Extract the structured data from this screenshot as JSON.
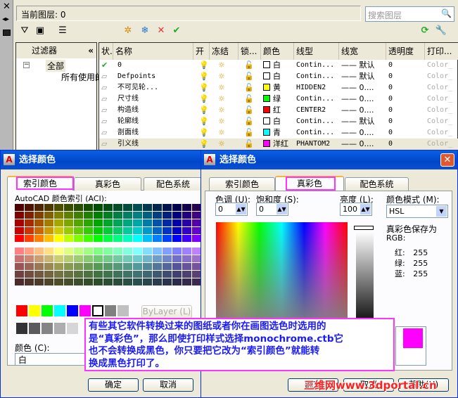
{
  "layer_manager": {
    "current_layer_label": "当前图层: 0",
    "search_placeholder": "搜索图层",
    "filter_header": "过滤器",
    "tree": [
      "全部",
      "所有使用的图层"
    ],
    "columns": [
      "状.",
      "名称",
      "开",
      "冻结",
      "锁...",
      "颜色",
      "线型",
      "线宽",
      "透明度",
      "打印..."
    ],
    "rows": [
      {
        "name": "0",
        "color": "白",
        "swatch": "#ffffff",
        "linetype": "Contin...",
        "lineweight": "默认",
        "transparency": "0",
        "plot": "Color_",
        "current": true
      },
      {
        "name": "Defpoints",
        "color": "白",
        "swatch": "#ffffff",
        "linetype": "Contin...",
        "lineweight": "默认",
        "transparency": "0",
        "plot": "Color_"
      },
      {
        "name": "不可见轮...",
        "color": "黄",
        "swatch": "#ffff00",
        "linetype": "HIDDEN2",
        "lineweight": "0....",
        "transparency": "0",
        "plot": "Color_"
      },
      {
        "name": "尺寸线",
        "color": "绿",
        "swatch": "#00ff00",
        "linetype": "Contin...",
        "lineweight": "0....",
        "transparency": "0",
        "plot": "Color_"
      },
      {
        "name": "构造线",
        "color": "红",
        "swatch": "#ff0000",
        "linetype": "CENTER2",
        "lineweight": "0....",
        "transparency": "0",
        "plot": "Color_"
      },
      {
        "name": "轮廓线",
        "color": "白",
        "swatch": "#ffffff",
        "linetype": "Contin...",
        "lineweight": "默认",
        "transparency": "0",
        "plot": "Color_"
      },
      {
        "name": "剖面线",
        "color": "青",
        "swatch": "#00ffff",
        "linetype": "Contin...",
        "lineweight": "0....",
        "transparency": "0",
        "plot": "Color_"
      },
      {
        "name": "引义线",
        "color": "洋红",
        "swatch": "#ff00ff",
        "linetype": "PHANTOM2",
        "lineweight": "0....",
        "transparency": "0",
        "plot": "Color_"
      }
    ]
  },
  "left_dialog": {
    "title": "选择颜色",
    "tabs": [
      "索引颜色",
      "真彩色",
      "配色系统"
    ],
    "aci_label": "AutoCAD 颜色索引 (ACI):",
    "standard_colors": [
      "#ff0000",
      "#ffff00",
      "#00ff00",
      "#00ffff",
      "#0000ff",
      "#ff00ff",
      "#ffffff",
      "#808080",
      "#c0c0c0"
    ],
    "grays": [
      "#333333",
      "#5b5b5b",
      "#848484",
      "#adadad",
      "#d6d6d6"
    ],
    "bylayer": "ByLayer (L)",
    "color_label": "颜色 (C):",
    "color_value": "白",
    "ok": "确定",
    "cancel": "取消"
  },
  "right_dialog": {
    "title": "选择颜色",
    "tabs": [
      "索引颜色",
      "真彩色",
      "配色系统"
    ],
    "hue_label": "色调 (U):",
    "hue": "0",
    "sat_label": "饱和度 (S):",
    "sat": "0",
    "lum_label": "亮度 (L):",
    "lum": "100",
    "mode_label": "颜色模式 (M):",
    "mode": "HSL",
    "saved_as": "真彩色保存为",
    "rgb": "RGB:",
    "red_label": "红:",
    "red": "255",
    "green_label": "绿:",
    "green": "255",
    "blue_label": "蓝:",
    "blue": "255",
    "ok": "确定",
    "cancel": "取消",
    "help": "帮助(H)"
  },
  "note": [
    "有些其它软件转换过来的图纸或者你在画图选色时选用的",
    "是“真彩色”，那么即使打印样式选择monochrome.ctb它",
    "也不会转换成黑色，你只要把它改为“索引颜色”就能转",
    "换成黑色打印了。"
  ],
  "watermark": "三维网www.3dportal.cn"
}
